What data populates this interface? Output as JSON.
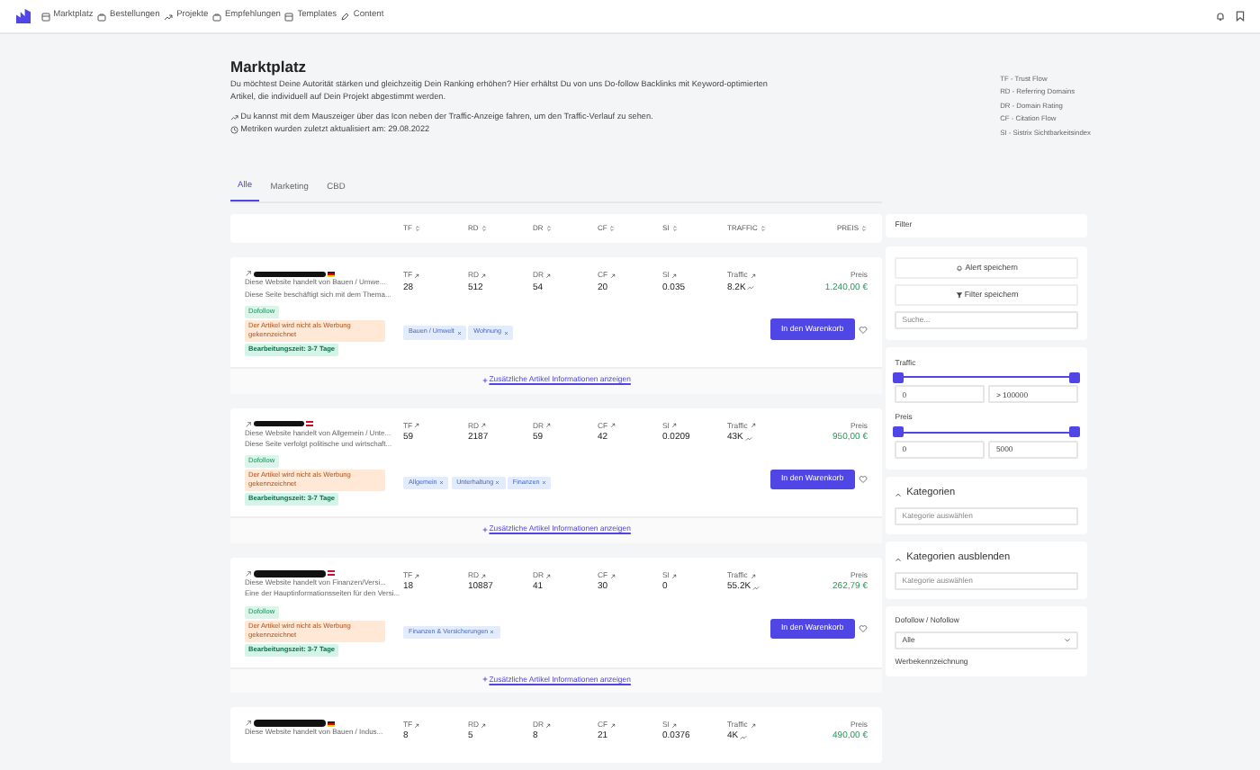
{
  "nav": {
    "items": [
      {
        "label": "Marktplatz"
      },
      {
        "label": "Bestellungen"
      },
      {
        "label": "Projekte"
      },
      {
        "label": "Empfehlungen"
      },
      {
        "label": "Templates"
      },
      {
        "label": "Content"
      }
    ]
  },
  "header": {
    "title": "Marktplatz",
    "description": "Du möchtest Deine Autorität stärken und gleichzeitig Dein Ranking erhöhen? Hier erhältst Du von uns Do-follow Backlinks mit Keyword-optimierten Artikel, die individuell auf Dein Projekt abgestimmt werden.",
    "notes": [
      {
        "kind": "trend",
        "text": "Du kannst mit dem Mauszeiger über das Icon neben der Traffic-Anzeige fahren, um den Traffic-Verlauf zu sehen."
      },
      {
        "kind": "clock",
        "text": "Metriken wurden zuletzt aktualisiert am: 29.08.2022"
      }
    ],
    "legend": [
      "TF - Trust Flow",
      "RD - Referring Domains",
      "DR - Domain Rating",
      "CF - Citation Flow",
      "SI - Sistrix Sichtbarkeitsindex"
    ]
  },
  "tabs": [
    {
      "label": "Alle",
      "selected": true
    },
    {
      "label": "Marketing",
      "selected": false
    },
    {
      "label": "CBD",
      "selected": false
    }
  ],
  "table": {
    "columns": [
      "TF",
      "RD",
      "DR",
      "CF",
      "SI",
      "TRAFFIC",
      "PREIS"
    ],
    "rows": [
      {
        "kind": "german",
        "descriptions": [
          "Diese Website handelt von Bauen / Umwe...",
          "Diese Seite beschäftigt sich mit dem Thema..."
        ],
        "badges": [
          {
            "kind": "success",
            "text": "Dofollow"
          },
          {
            "kind": "warning",
            "text": "Der Artikel wird nicht als Werbung gekennzeichnet"
          },
          {
            "kind": "time",
            "text": "Bearbeitungszeit: 3-7 Tage"
          }
        ],
        "metrics": [
          {
            "label": "TF",
            "value": "28"
          },
          {
            "label": "RD",
            "value": "512"
          },
          {
            "label": "DR",
            "value": "54"
          },
          {
            "label": "CF",
            "value": "20"
          },
          {
            "label": "SI",
            "value": "0.035"
          },
          {
            "label": "Traffic",
            "value": "8.2K"
          }
        ],
        "price_label": "Preis",
        "price": "1.240,00 €",
        "tags": [
          "Bauen / Umwelt",
          "Wohnung"
        ],
        "button": "In den Warenkorb",
        "more_link": "Zusätzliche Artikel Informationen anzeigen"
      },
      {
        "kind": "austrian",
        "descriptions": [
          "Diese Website handelt von Allgemein / Unte...",
          "Diese Seite verfolgt politische und wirtschaft..."
        ],
        "badges": [
          {
            "kind": "success",
            "text": "Dofollow"
          },
          {
            "kind": "warning",
            "text": "Der Artikel wird nicht als Werbung gekennzeichnet"
          },
          {
            "kind": "time",
            "text": "Bearbeitungszeit: 3-7 Tage"
          }
        ],
        "metrics": [
          {
            "label": "TF",
            "value": "59"
          },
          {
            "label": "RD",
            "value": "2187"
          },
          {
            "label": "DR",
            "value": "59"
          },
          {
            "label": "CF",
            "value": "42"
          },
          {
            "label": "SI",
            "value": "0.0209"
          },
          {
            "label": "Traffic",
            "value": "43K"
          }
        ],
        "price_label": "Preis",
        "price": "950,00 €",
        "tags": [
          "Allgemein",
          "Unterhaltung",
          "Finanzen"
        ],
        "button": "In den Warenkorb",
        "more_link": "Zusätzliche Artikel Informationen anzeigen"
      },
      {
        "kind": "austrian",
        "descriptions": [
          "Diese Website handelt von Finanzen/Versi...",
          "Eine der Hauptinformationsseiten für den Versi..."
        ],
        "badges": [
          {
            "kind": "success",
            "text": "Dofollow"
          },
          {
            "kind": "warning",
            "text": "Der Artikel wird nicht als Werbung gekennzeichnet"
          },
          {
            "kind": "time",
            "text": "Bearbeitungszeit: 3-7 Tage"
          }
        ],
        "metrics": [
          {
            "label": "TF",
            "value": "18"
          },
          {
            "label": "RD",
            "value": "10887"
          },
          {
            "label": "DR",
            "value": "41"
          },
          {
            "label": "CF",
            "value": "30"
          },
          {
            "label": "SI",
            "value": "0"
          },
          {
            "label": "Traffic",
            "value": "55.2K"
          }
        ],
        "price_label": "Preis",
        "price": "262,79 €",
        "tags": [
          "Finanzen & Versicherungen"
        ],
        "button": "In den Warenkorb",
        "more_link": "Zusätzliche Artikel Informationen anzeigen"
      },
      {
        "kind": "german",
        "descriptions": [
          "Diese Website handelt von Bauen / Indus..."
        ],
        "badges": [],
        "metrics": [
          {
            "label": "TF",
            "value": "8"
          },
          {
            "label": "RD",
            "value": "5"
          },
          {
            "label": "DR",
            "value": "8"
          },
          {
            "label": "CF",
            "value": "21"
          },
          {
            "label": "SI",
            "value": "0.0376"
          },
          {
            "label": "Traffic",
            "value": "4K"
          }
        ],
        "price_label": "Preis",
        "price": "490,00 €",
        "tags": []
      }
    ]
  },
  "sidebar": {
    "title": "Filter",
    "buttons": [
      {
        "label": "Alert speichern"
      },
      {
        "label": "Filter speichern"
      }
    ],
    "search": {
      "placeholder": "Suche..."
    },
    "ranges": [
      {
        "label": "Traffic",
        "thumbs": [
          {
            "level": 0
          },
          {
            "level": 1
          }
        ],
        "min": "0",
        "max": "> 100000"
      },
      {
        "label": "Preis",
        "thumbs": [
          {
            "level": 0
          },
          {
            "level": 1
          }
        ],
        "min": "0",
        "max": "5000"
      }
    ],
    "sections": [
      {
        "title": "Kategorien",
        "expanded": true,
        "placeholder": "Kategorie auswählen"
      },
      {
        "title": "Kategorien ausblenden",
        "expanded": true,
        "placeholder": "Kategorie auswählen"
      }
    ],
    "selects": [
      {
        "label": "Dofollow / Nofollow",
        "value": "Alle"
      },
      {
        "label": "Werbekennzeichnung"
      }
    ]
  }
}
